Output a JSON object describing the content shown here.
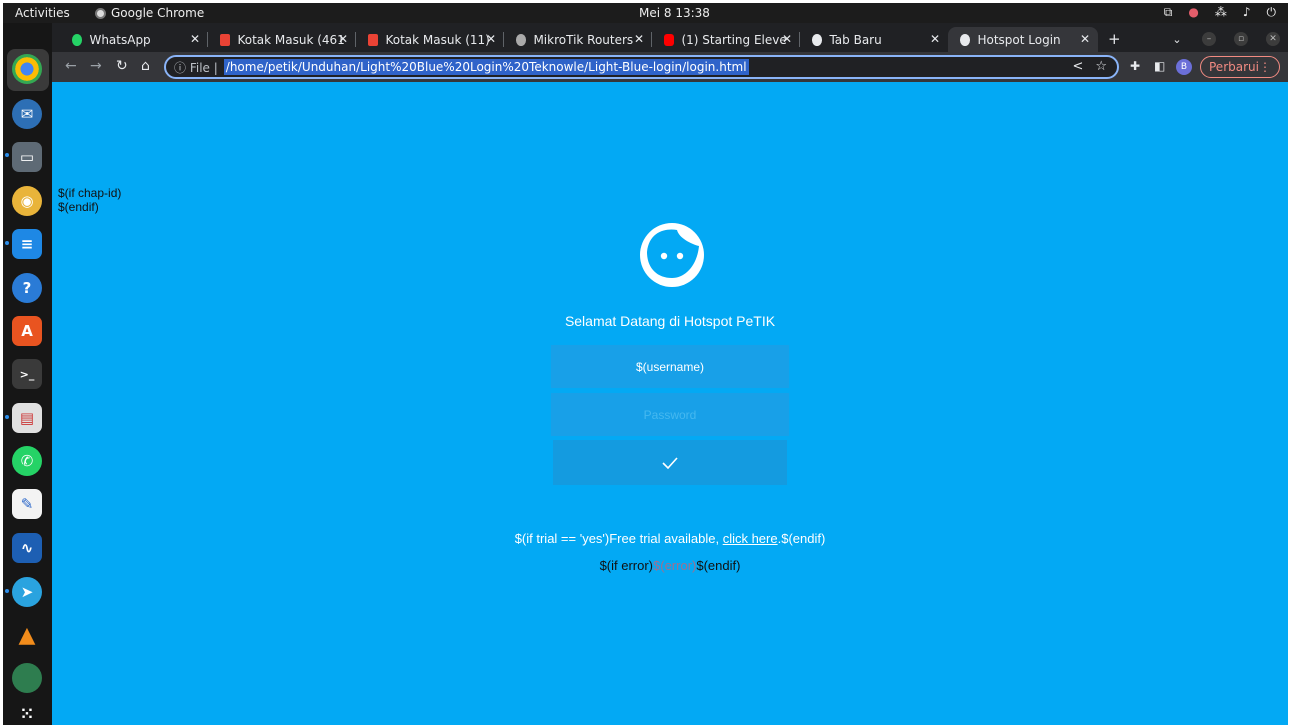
{
  "topbar": {
    "activities": "Activities",
    "app_name": "Google Chrome",
    "clock": "Mei 8  13:38"
  },
  "tabs": [
    {
      "label": "WhatsApp",
      "icon": "whatsapp-icon",
      "color": "#25d366"
    },
    {
      "label": "Kotak Masuk (461",
      "icon": "gmail-icon",
      "color": "#ea4335"
    },
    {
      "label": "Kotak Masuk (11)",
      "icon": "gmail-icon",
      "color": "#ea4335"
    },
    {
      "label": "MikroTik Routers",
      "icon": "mikrotik-icon",
      "color": "#cccccc"
    },
    {
      "label": "(1) Starting Eleve",
      "icon": "youtube-icon",
      "color": "#ff0000"
    },
    {
      "label": "Tab Baru",
      "icon": "chrome-icon",
      "color": "#e8eaed"
    },
    {
      "label": "Hotspot Login",
      "icon": "globe-icon",
      "color": "#e8eaed"
    }
  ],
  "toolbar": {
    "info_label": "File",
    "url": "/home/petik/Unduhan/Light%20Blue%20Login%20Teknowle/Light-Blue-login/login.html",
    "avatar_letter": "B",
    "update_label": "Perbarui"
  },
  "page": {
    "chap_if": "$(if chap-id)",
    "chap_endif": "$(endif)",
    "welcome": "Selamat Datang di Hotspot PeTIK",
    "username_value": "$(username)",
    "password_placeholder": "Password",
    "trial_prefix": "$(if trial == 'yes')Free trial available, ",
    "trial_link": "click here",
    "trial_suffix": ".$(endif)",
    "err_prefix": "$(if error)",
    "err_value": "$(error)",
    "err_suffix": "$(endif)"
  },
  "colors": {
    "page_bg": "#03a9f4",
    "field_bg": "#18a0e8",
    "accent": "#8ab4f8"
  }
}
